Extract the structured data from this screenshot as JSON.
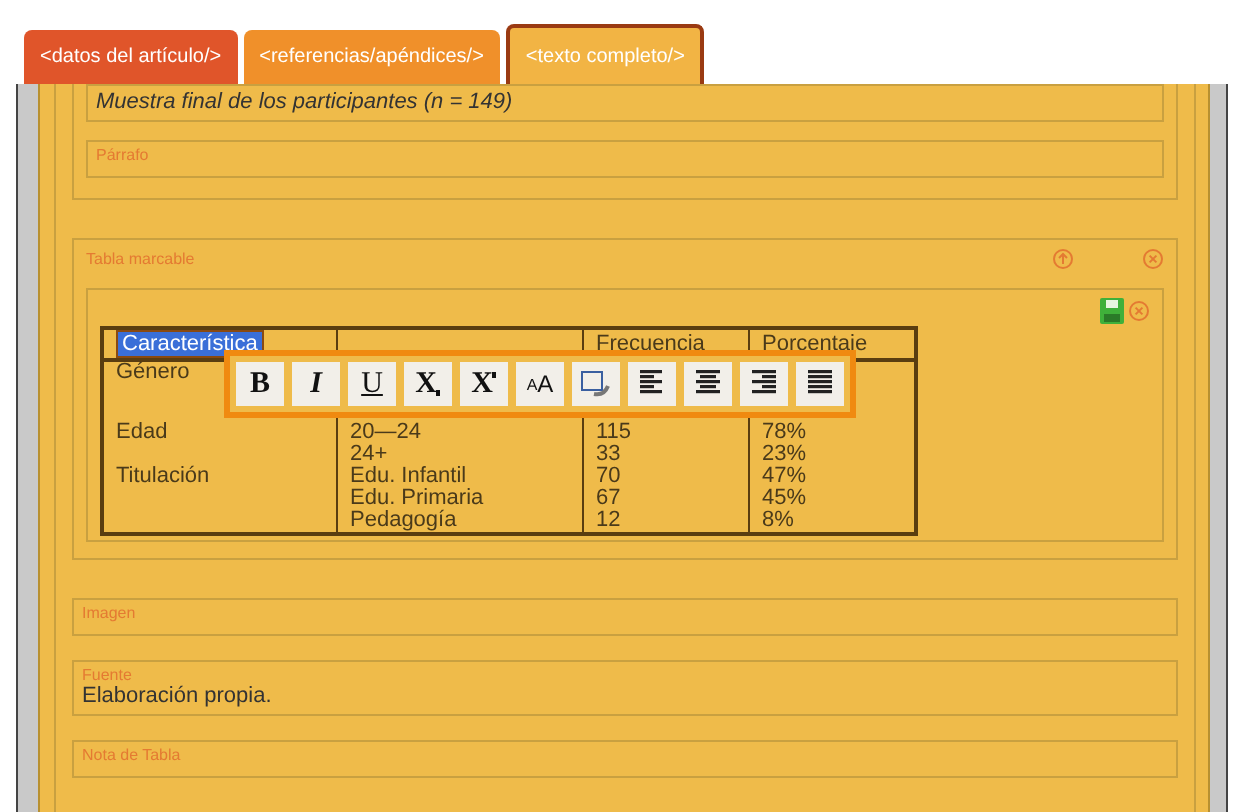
{
  "tabs": [
    {
      "label": "<datos del artículo/>",
      "selected": false,
      "color": "#e0552a"
    },
    {
      "label": "<referencias/apéndices/>",
      "selected": false,
      "color": "#f0902a"
    },
    {
      "label": "<texto completo/>",
      "selected": true,
      "color": "#f2b444"
    }
  ],
  "caption_field": {
    "value": "Muestra final de los participantes (n = 149)"
  },
  "paragraph_field": {
    "label": "Párrafo"
  },
  "table_panel": {
    "label": "Tabla marcable",
    "columns": [
      {
        "label": "Característica",
        "selected": true
      },
      {
        "selected": false
      },
      {
        "label": "Frecuencia",
        "selected": false
      },
      {
        "label": "Porcentaje",
        "selected": false
      }
    ],
    "rows": [
      {
        "label": "Género"
      },
      {
        "label": "Edad",
        "values": [
          "20—24\n24+",
          "115\n33",
          "78%\n23%"
        ]
      },
      {
        "label": "Titulación",
        "values": [
          "Edu. Infantil\nEdu. Primaria\nPedagogía",
          "70\n67\n12",
          "47%\n45%\n8%"
        ]
      }
    ],
    "toolbar": [
      {
        "kind": "bold",
        "label": "B"
      },
      {
        "kind": "italic",
        "label": "I"
      },
      {
        "kind": "underline",
        "label": "U"
      },
      {
        "kind": "subscript",
        "label": "X"
      },
      {
        "kind": "superscript",
        "label": "X"
      },
      {
        "kind": "fontsize",
        "label": "A",
        "small": "A"
      },
      {
        "kind": "paste"
      },
      {
        "kind": "align-left"
      },
      {
        "kind": "align-center"
      },
      {
        "kind": "align-right"
      },
      {
        "kind": "justify"
      }
    ]
  },
  "image_field": {
    "label": "Imagen"
  },
  "source_field": {
    "label": "Fuente",
    "value": "Elaboración propia."
  },
  "note_field": {
    "label": "Nota de Tabla"
  }
}
